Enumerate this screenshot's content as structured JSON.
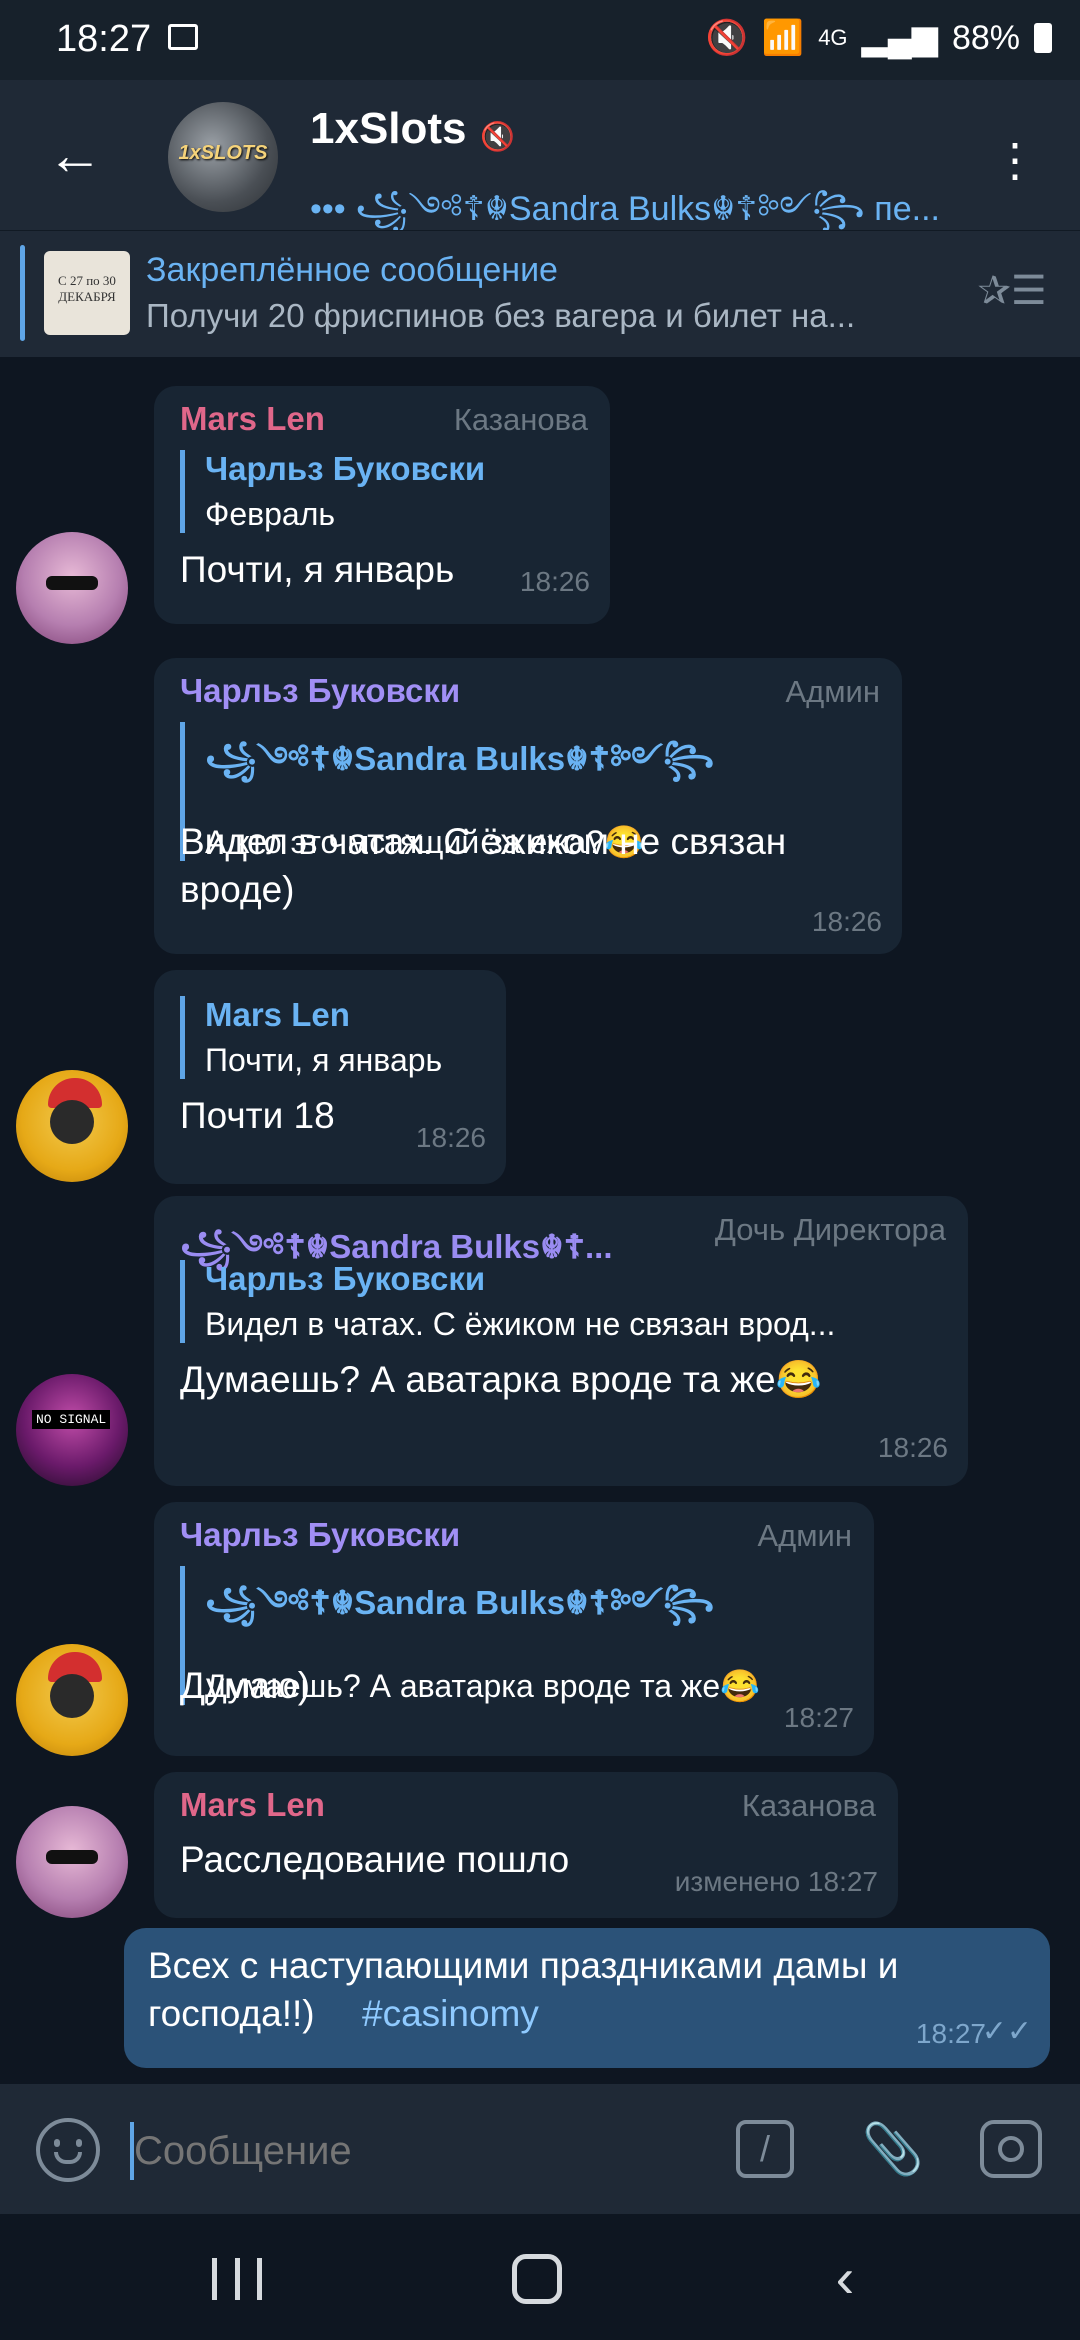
{
  "status_bar": {
    "time": "18:27",
    "network": "4G",
    "battery": "88%"
  },
  "header": {
    "title": "1xSlots",
    "subtitle": "••• ꧁༺☦︎☬Sandra Bulks☬☦︎༻꧂ пе...",
    "avatar_text": "1xSLOTS"
  },
  "pinned": {
    "title": "Закреплённое сообщение",
    "text": "Получи 20 фриспинов без вагера и билет на...",
    "thumb_text": "С 27 по 30 ДЕКАБРЯ"
  },
  "messages": [
    {
      "sender": "Mars Len",
      "role": "Казанова",
      "reply_name": "Чарльз Буковски",
      "reply_text": "Февраль",
      "text": "Почти, я январь",
      "time": "18:26"
    },
    {
      "sender": "Чарльз Буковски",
      "role": "Админ",
      "reply_name": "꧁༺☦︎☬Sandra Bulks☬☦︎༻꧂",
      "reply_text": "А кто это мстящий за ежа?😂",
      "text_line1": "Видел в чатах. С ёжиком не связан",
      "text_line2": "вроде)",
      "time": "18:26"
    },
    {
      "reply_name": "Mars Len",
      "reply_text": "Почти, я январь",
      "text": "Почти 18",
      "time": "18:26"
    },
    {
      "sender": "꧁༺☦︎☬Sandra Bulks☬☦︎...",
      "role": "Дочь Директора",
      "reply_name": "Чарльз Буковски",
      "reply_text": "Видел в чатах. С ёжиком не связан врод...",
      "text": "Думаешь? А аватарка вроде та же😂",
      "time": "18:26"
    },
    {
      "sender": "Чарльз Буковски",
      "role": "Админ",
      "reply_name": "꧁༺☦︎☬Sandra Bulks☬☦︎༻꧂",
      "reply_text": "Думаешь? А аватарка вроде та же😂",
      "text": "Думаю)",
      "time": "18:27"
    },
    {
      "sender": "Mars Len",
      "role": "Казанова",
      "text": "Расследование пошло",
      "time": "изменено 18:27"
    },
    {
      "text_line1": "Всех с наступающими праздниками дамы и",
      "text_line2": "господа!!)",
      "hashtag": "#casinomy",
      "time": "18:27"
    }
  ],
  "input": {
    "placeholder": "Сообщение"
  },
  "colors": {
    "background": "#0e1621",
    "bubble_in": "#182533",
    "bubble_out": "#2b5278",
    "accent": "#6ab3f3",
    "mars_name": "#e0678a",
    "charles_name": "#a18ff5",
    "sandra_name": "#9a8cf2"
  }
}
